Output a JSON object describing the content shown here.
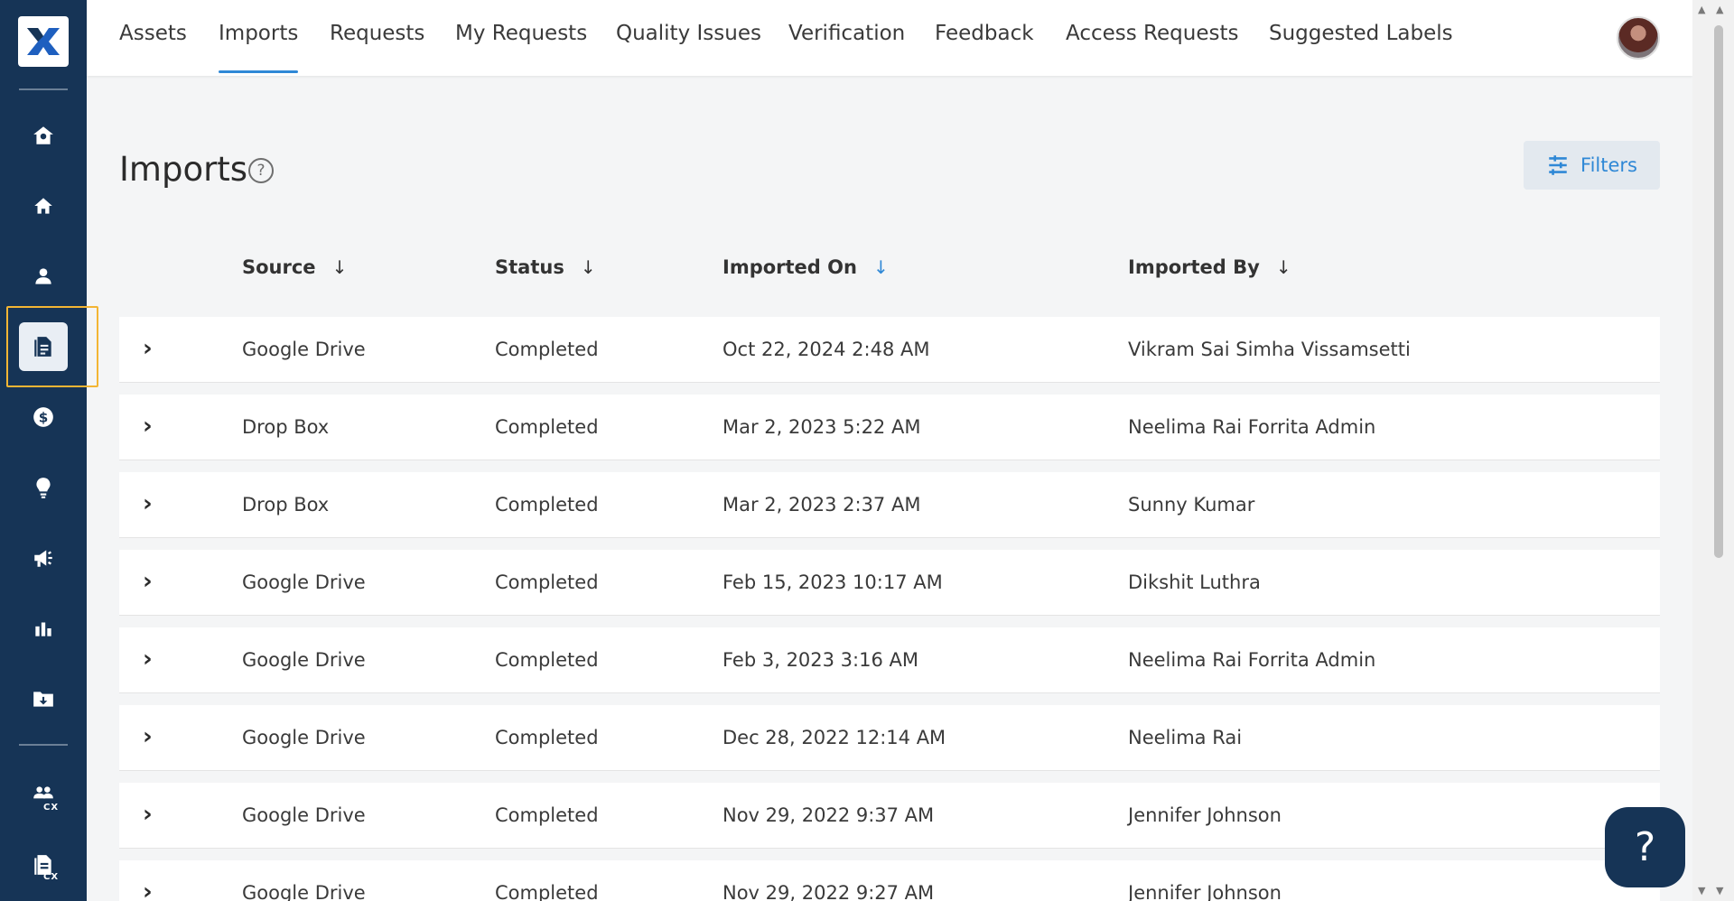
{
  "nav": {
    "tabs": [
      {
        "label": "Assets"
      },
      {
        "label": "Imports"
      },
      {
        "label": "Requests"
      },
      {
        "label": "My Requests"
      },
      {
        "label": "Quality Issues"
      },
      {
        "label": "Verification"
      },
      {
        "label": "Feedback"
      },
      {
        "label": "Access Requests"
      },
      {
        "label": "Suggested Labels"
      }
    ],
    "active_tab": "Imports"
  },
  "sidebar": {
    "items": [
      {
        "icon": "home-settings-icon"
      },
      {
        "icon": "home-icon"
      },
      {
        "icon": "person-icon"
      },
      {
        "icon": "document-icon",
        "active": true
      },
      {
        "icon": "dollar-icon"
      },
      {
        "icon": "lightbulb-icon"
      },
      {
        "icon": "megaphone-icon"
      },
      {
        "icon": "bar-chart-icon"
      },
      {
        "icon": "download-folder-icon"
      },
      {
        "icon": "people-cx-icon",
        "badge": "CX"
      },
      {
        "icon": "document-cx-icon",
        "badge": "CX"
      }
    ]
  },
  "page": {
    "title": "Imports",
    "help_glyph": "?",
    "filters_label": "Filters"
  },
  "table": {
    "columns": [
      "Source",
      "Status",
      "Imported On",
      "Imported By"
    ],
    "sorted_column": "Imported On",
    "rows": [
      {
        "source": "Google Drive",
        "status": "Completed",
        "imported_on": "Oct 22, 2024 2:48 AM",
        "imported_by": "Vikram Sai Simha Vissamsetti"
      },
      {
        "source": "Drop Box",
        "status": "Completed",
        "imported_on": "Mar 2, 2023 5:22 AM",
        "imported_by": "Neelima Rai Forrita Admin"
      },
      {
        "source": "Drop Box",
        "status": "Completed",
        "imported_on": "Mar 2, 2023 2:37 AM",
        "imported_by": "Sunny Kumar"
      },
      {
        "source": "Google Drive",
        "status": "Completed",
        "imported_on": "Feb 15, 2023 10:17 AM",
        "imported_by": "Dikshit Luthra"
      },
      {
        "source": "Google Drive",
        "status": "Completed",
        "imported_on": "Feb 3, 2023 3:16 AM",
        "imported_by": "Neelima Rai Forrita Admin"
      },
      {
        "source": "Google Drive",
        "status": "Completed",
        "imported_on": "Dec 28, 2022 12:14 AM",
        "imported_by": "Neelima Rai"
      },
      {
        "source": "Google Drive",
        "status": "Completed",
        "imported_on": "Nov 29, 2022 9:37 AM",
        "imported_by": "Jennifer Johnson"
      },
      {
        "source": "Google Drive",
        "status": "Completed",
        "imported_on": "Nov 29, 2022 9:27 AM",
        "imported_by": "Jennifer Johnson"
      }
    ]
  },
  "fab": {
    "label": "?"
  },
  "colors": {
    "sidebar_bg": "#163456",
    "accent": "#2f88d6",
    "highlight": "#f3b534"
  }
}
